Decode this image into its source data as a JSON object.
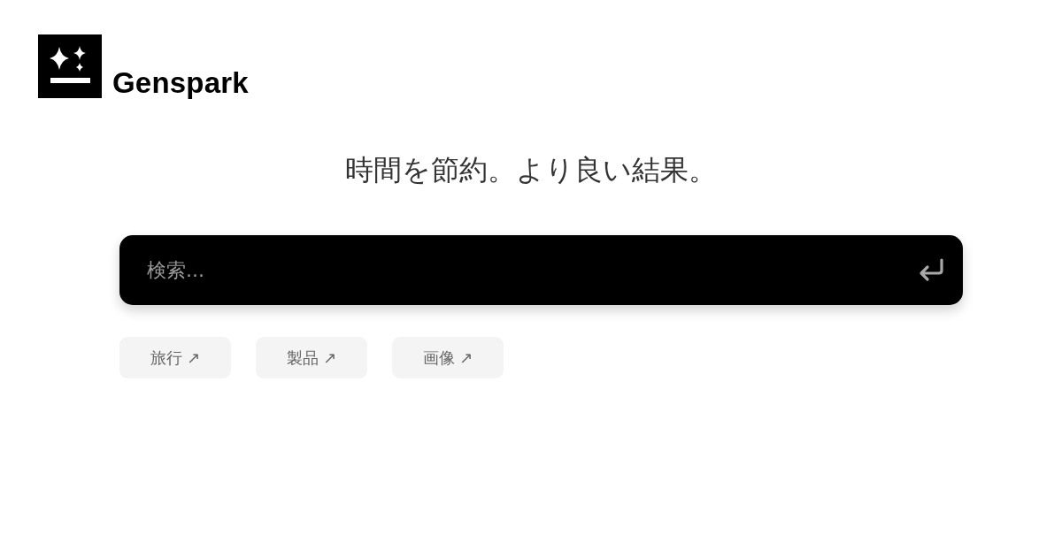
{
  "brand": {
    "name": "Genspark"
  },
  "headline": "時間を節約。より良い結果。",
  "search": {
    "placeholder": "検索..."
  },
  "suggestions": [
    {
      "label": "旅行 ↗"
    },
    {
      "label": "製品 ↗"
    },
    {
      "label": "画像 ↗"
    }
  ]
}
